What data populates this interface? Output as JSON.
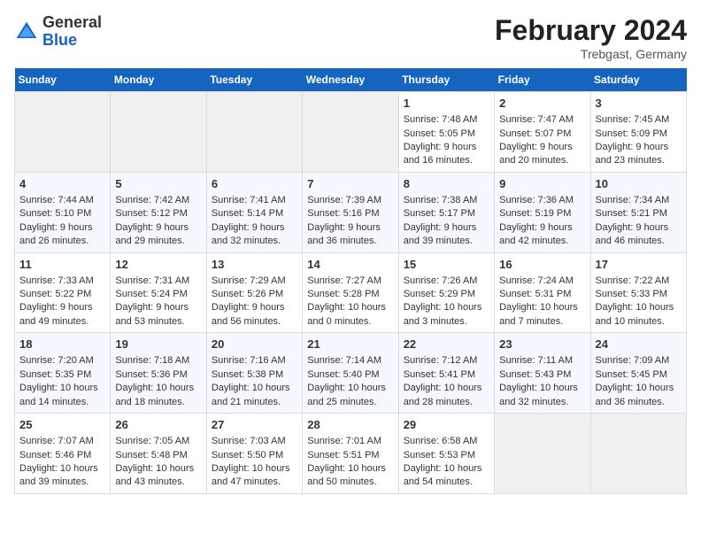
{
  "header": {
    "logo_general": "General",
    "logo_blue": "Blue",
    "title": "February 2024",
    "subtitle": "Trebgast, Germany"
  },
  "weekdays": [
    "Sunday",
    "Monday",
    "Tuesday",
    "Wednesday",
    "Thursday",
    "Friday",
    "Saturday"
  ],
  "weeks": [
    [
      {
        "day": "",
        "empty": true
      },
      {
        "day": "",
        "empty": true
      },
      {
        "day": "",
        "empty": true
      },
      {
        "day": "",
        "empty": true
      },
      {
        "day": "1",
        "sunrise": "7:48 AM",
        "sunset": "5:05 PM",
        "daylight": "9 hours and 16 minutes."
      },
      {
        "day": "2",
        "sunrise": "7:47 AM",
        "sunset": "5:07 PM",
        "daylight": "9 hours and 20 minutes."
      },
      {
        "day": "3",
        "sunrise": "7:45 AM",
        "sunset": "5:09 PM",
        "daylight": "9 hours and 23 minutes."
      }
    ],
    [
      {
        "day": "4",
        "sunrise": "7:44 AM",
        "sunset": "5:10 PM",
        "daylight": "9 hours and 26 minutes."
      },
      {
        "day": "5",
        "sunrise": "7:42 AM",
        "sunset": "5:12 PM",
        "daylight": "9 hours and 29 minutes."
      },
      {
        "day": "6",
        "sunrise": "7:41 AM",
        "sunset": "5:14 PM",
        "daylight": "9 hours and 32 minutes."
      },
      {
        "day": "7",
        "sunrise": "7:39 AM",
        "sunset": "5:16 PM",
        "daylight": "9 hours and 36 minutes."
      },
      {
        "day": "8",
        "sunrise": "7:38 AM",
        "sunset": "5:17 PM",
        "daylight": "9 hours and 39 minutes."
      },
      {
        "day": "9",
        "sunrise": "7:36 AM",
        "sunset": "5:19 PM",
        "daylight": "9 hours and 42 minutes."
      },
      {
        "day": "10",
        "sunrise": "7:34 AM",
        "sunset": "5:21 PM",
        "daylight": "9 hours and 46 minutes."
      }
    ],
    [
      {
        "day": "11",
        "sunrise": "7:33 AM",
        "sunset": "5:22 PM",
        "daylight": "9 hours and 49 minutes."
      },
      {
        "day": "12",
        "sunrise": "7:31 AM",
        "sunset": "5:24 PM",
        "daylight": "9 hours and 53 minutes."
      },
      {
        "day": "13",
        "sunrise": "7:29 AM",
        "sunset": "5:26 PM",
        "daylight": "9 hours and 56 minutes."
      },
      {
        "day": "14",
        "sunrise": "7:27 AM",
        "sunset": "5:28 PM",
        "daylight": "10 hours and 0 minutes."
      },
      {
        "day": "15",
        "sunrise": "7:26 AM",
        "sunset": "5:29 PM",
        "daylight": "10 hours and 3 minutes."
      },
      {
        "day": "16",
        "sunrise": "7:24 AM",
        "sunset": "5:31 PM",
        "daylight": "10 hours and 7 minutes."
      },
      {
        "day": "17",
        "sunrise": "7:22 AM",
        "sunset": "5:33 PM",
        "daylight": "10 hours and 10 minutes."
      }
    ],
    [
      {
        "day": "18",
        "sunrise": "7:20 AM",
        "sunset": "5:35 PM",
        "daylight": "10 hours and 14 minutes."
      },
      {
        "day": "19",
        "sunrise": "7:18 AM",
        "sunset": "5:36 PM",
        "daylight": "10 hours and 18 minutes."
      },
      {
        "day": "20",
        "sunrise": "7:16 AM",
        "sunset": "5:38 PM",
        "daylight": "10 hours and 21 minutes."
      },
      {
        "day": "21",
        "sunrise": "7:14 AM",
        "sunset": "5:40 PM",
        "daylight": "10 hours and 25 minutes."
      },
      {
        "day": "22",
        "sunrise": "7:12 AM",
        "sunset": "5:41 PM",
        "daylight": "10 hours and 28 minutes."
      },
      {
        "day": "23",
        "sunrise": "7:11 AM",
        "sunset": "5:43 PM",
        "daylight": "10 hours and 32 minutes."
      },
      {
        "day": "24",
        "sunrise": "7:09 AM",
        "sunset": "5:45 PM",
        "daylight": "10 hours and 36 minutes."
      }
    ],
    [
      {
        "day": "25",
        "sunrise": "7:07 AM",
        "sunset": "5:46 PM",
        "daylight": "10 hours and 39 minutes."
      },
      {
        "day": "26",
        "sunrise": "7:05 AM",
        "sunset": "5:48 PM",
        "daylight": "10 hours and 43 minutes."
      },
      {
        "day": "27",
        "sunrise": "7:03 AM",
        "sunset": "5:50 PM",
        "daylight": "10 hours and 47 minutes."
      },
      {
        "day": "28",
        "sunrise": "7:01 AM",
        "sunset": "5:51 PM",
        "daylight": "10 hours and 50 minutes."
      },
      {
        "day": "29",
        "sunrise": "6:58 AM",
        "sunset": "5:53 PM",
        "daylight": "10 hours and 54 minutes."
      },
      {
        "day": "",
        "empty": true
      },
      {
        "day": "",
        "empty": true
      }
    ]
  ]
}
